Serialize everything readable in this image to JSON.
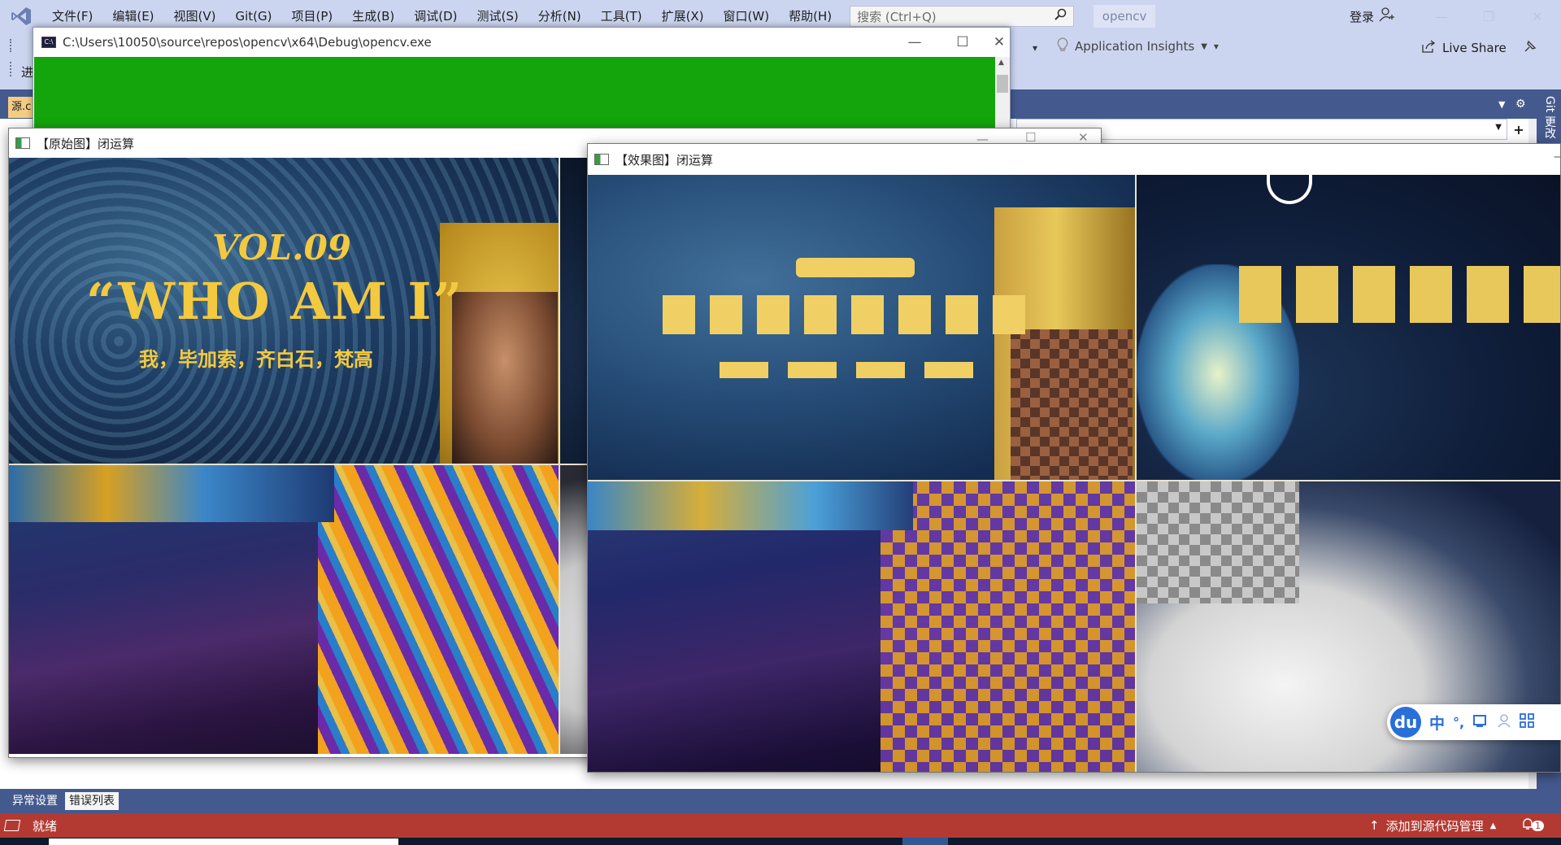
{
  "menu": {
    "items": [
      "文件(F)",
      "编辑(E)",
      "视图(V)",
      "Git(G)",
      "项目(P)",
      "生成(B)",
      "调试(D)",
      "测试(S)",
      "分析(N)",
      "工具(T)",
      "扩展(X)",
      "窗口(W)",
      "帮助(H)"
    ],
    "search_placeholder": "搜索 (Ctrl+Q)",
    "solution_name": "opencv",
    "login": "登录"
  },
  "toolbar": {
    "app_insights": "Application Insights",
    "live_share": "Live Share",
    "left_partial": "进"
  },
  "doc_tab": "源.c",
  "git_changes": "Git 更改",
  "console": {
    "title": "C:\\Users\\10050\\source\\repos\\opencv\\x64\\Debug\\opencv.exe",
    "bg_color": "#14a40c"
  },
  "original_window": {
    "title": "【原始图】闭运算",
    "image": {
      "vol": "VOL.09",
      "headline": "“WHO AM I”",
      "subtitle": "我，毕加索，齐白石，梵高"
    }
  },
  "effect_window": {
    "title": "【效果图】闭运算"
  },
  "bottom_tabs": [
    "异常设置",
    "错误列表"
  ],
  "status": {
    "text": "就绪",
    "source_control": "添加到源代码管理",
    "notifications": "1",
    "bar_color": "#b33a32"
  },
  "ime": {
    "logo": "du",
    "lang": "中",
    "punct": "°,"
  },
  "colors": {
    "vs_chrome": "#ccd5f0",
    "vs_dark": "#445a8f",
    "accent_yellow": "#f3c93f"
  }
}
